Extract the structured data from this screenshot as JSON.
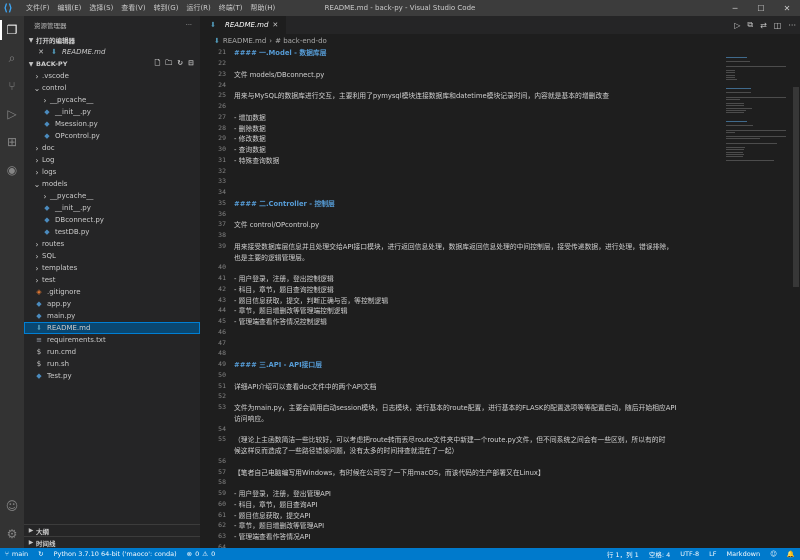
{
  "titlebar": {
    "title": "README.md - back-py - Visual Studio Code",
    "menu": [
      "文件(F)",
      "编辑(E)",
      "选择(S)",
      "查看(V)",
      "转到(G)",
      "运行(R)",
      "终端(T)",
      "帮助(H)"
    ]
  },
  "sidebar": {
    "header": "资源管理器",
    "open_editors_label": "打开的编辑器",
    "open_editor_file": "README.md",
    "project_label": "BACK-PY",
    "bottom_sections": [
      "大纲",
      "时间线"
    ]
  },
  "tree": [
    {
      "label": ".vscode",
      "type": "folder",
      "depth": 1,
      "expanded": false
    },
    {
      "label": "control",
      "type": "folder",
      "depth": 1,
      "expanded": true
    },
    {
      "label": "__pycache__",
      "type": "folder",
      "depth": 2,
      "expanded": false
    },
    {
      "label": "__init__.py",
      "type": "py",
      "depth": 2
    },
    {
      "label": "Msession.py",
      "type": "py",
      "depth": 2
    },
    {
      "label": "OPcontrol.py",
      "type": "py",
      "depth": 2
    },
    {
      "label": "doc",
      "type": "folder",
      "depth": 1,
      "expanded": false
    },
    {
      "label": "Log",
      "type": "folder",
      "depth": 1,
      "expanded": false
    },
    {
      "label": "logs",
      "type": "folder",
      "depth": 1,
      "expanded": false
    },
    {
      "label": "models",
      "type": "folder",
      "depth": 1,
      "expanded": true
    },
    {
      "label": "__pycache__",
      "type": "folder",
      "depth": 2,
      "expanded": false
    },
    {
      "label": "__init__.py",
      "type": "py",
      "depth": 2
    },
    {
      "label": "DBconnect.py",
      "type": "py",
      "depth": 2
    },
    {
      "label": "testDB.py",
      "type": "py",
      "depth": 2
    },
    {
      "label": "routes",
      "type": "folder",
      "depth": 1,
      "expanded": false
    },
    {
      "label": "SQL",
      "type": "folder",
      "depth": 1,
      "expanded": false
    },
    {
      "label": "templates",
      "type": "folder",
      "depth": 1,
      "expanded": false
    },
    {
      "label": "test",
      "type": "folder",
      "depth": 1,
      "expanded": false
    },
    {
      "label": ".gitignore",
      "type": "git",
      "depth": 1
    },
    {
      "label": "app.py",
      "type": "py",
      "depth": 1
    },
    {
      "label": "main.py",
      "type": "py",
      "depth": 1
    },
    {
      "label": "README.md",
      "type": "md",
      "depth": 1,
      "selected": true
    },
    {
      "label": "requirements.txt",
      "type": "txt",
      "depth": 1
    },
    {
      "label": "run.cmd",
      "type": "cmd",
      "depth": 1
    },
    {
      "label": "run.sh",
      "type": "cmd",
      "depth": 1
    },
    {
      "label": "Test.py",
      "type": "py",
      "depth": 1
    }
  ],
  "editor": {
    "tab_label": "README.md",
    "breadcrumb": [
      "README.md",
      "# back-end-do"
    ],
    "lines": [
      {
        "n": "21",
        "text": "#### 一.Model - 数据库层",
        "kind": "h4"
      },
      {
        "n": "22",
        "text": "",
        "kind": "text"
      },
      {
        "n": "23",
        "text": "文件 models/DBconnect.py",
        "kind": "text"
      },
      {
        "n": "24",
        "text": "",
        "kind": "text"
      },
      {
        "n": "25",
        "text": "用来与MySQL的数据库进行交互，主要利用了pymysql模块连接数据库和datetime模块记录时间，内容就是基本的增删改查",
        "kind": "text"
      },
      {
        "n": "26",
        "text": "",
        "kind": "text"
      },
      {
        "n": "27",
        "text": "- 增加数据",
        "kind": "list"
      },
      {
        "n": "28",
        "text": "- 删除数据",
        "kind": "list"
      },
      {
        "n": "29",
        "text": "- 修改数据",
        "kind": "list"
      },
      {
        "n": "30",
        "text": "- 查询数据",
        "kind": "list"
      },
      {
        "n": "31",
        "text": "- 特殊查询数据",
        "kind": "list"
      },
      {
        "n": "32",
        "text": "",
        "kind": "text"
      },
      {
        "n": "33",
        "text": "",
        "kind": "text"
      },
      {
        "n": "34",
        "text": "",
        "kind": "text"
      },
      {
        "n": "35",
        "text": "#### 二.Controller - 控制层",
        "kind": "h4"
      },
      {
        "n": "36",
        "text": "",
        "kind": "text"
      },
      {
        "n": "37",
        "text": "文件 control/OPcontrol.py",
        "kind": "text"
      },
      {
        "n": "38",
        "text": "",
        "kind": "text"
      },
      {
        "n": "39",
        "text": "用来接受数据库层信息并且处理交给API接口模块，进行返回信息处理，数据库返回信息处理的中间控制层，接受传递数据，进行处理，错误排除，",
        "kind": "text"
      },
      {
        "n": "",
        "text": "也是主要的逻辑管理层。",
        "kind": "text"
      },
      {
        "n": "40",
        "text": "",
        "kind": "text"
      },
      {
        "n": "41",
        "text": "- 用户登录，注册，登出控制逻辑",
        "kind": "list"
      },
      {
        "n": "42",
        "text": "- 科目，章节，题目查询控制逻辑",
        "kind": "list"
      },
      {
        "n": "43",
        "text": "- 题目信息获取，提交，判断正确与否，等控制逻辑",
        "kind": "list"
      },
      {
        "n": "44",
        "text": "- 章节，题目增删改等管理端控制逻辑",
        "kind": "list"
      },
      {
        "n": "45",
        "text": "- 管理端查看作答情况控制逻辑",
        "kind": "list"
      },
      {
        "n": "46",
        "text": "",
        "kind": "text"
      },
      {
        "n": "47",
        "text": "",
        "kind": "text"
      },
      {
        "n": "48",
        "text": "",
        "kind": "text"
      },
      {
        "n": "49",
        "text": "#### 三.API - API接口层",
        "kind": "h4"
      },
      {
        "n": "50",
        "text": "",
        "kind": "text"
      },
      {
        "n": "51",
        "text": "详细API介绍可以查看doc文件中的两个API文档",
        "kind": "text"
      },
      {
        "n": "52",
        "text": "",
        "kind": "text"
      },
      {
        "n": "53",
        "text": "文件为main.py，主要会调用启动session模块，日志模块，进行基本的route配置，进行基本的FLASK的配置选项等等配置启动，随后开始相应API",
        "kind": "text"
      },
      {
        "n": "",
        "text": "访问响应。",
        "kind": "text"
      },
      {
        "n": "54",
        "text": "",
        "kind": "text"
      },
      {
        "n": "55",
        "text": "（理论上主函数简洁一些比较好，可以考虑把route转而丢尽route文件夹中新建一个route.py文件，但不同系统之间会有一些区别，所以有的时",
        "kind": "text"
      },
      {
        "n": "",
        "text": "候这样反而造成了一些路径错误问题，没有太多的时间排查就混在了一起）",
        "kind": "text"
      },
      {
        "n": "56",
        "text": "",
        "kind": "text"
      },
      {
        "n": "57",
        "text": "【笔者自己电脑编写用Windows，有时候在公司写了一下用macOS，而该代码的生产部署又在Linux】",
        "kind": "text"
      },
      {
        "n": "58",
        "text": "",
        "kind": "text"
      },
      {
        "n": "59",
        "text": "- 用户登录，注册，登出管理API",
        "kind": "list"
      },
      {
        "n": "60",
        "text": "- 科目，章节，题目查询API",
        "kind": "list"
      },
      {
        "n": "61",
        "text": "- 题目信息获取，提交API",
        "kind": "list"
      },
      {
        "n": "62",
        "text": "- 章节，题目增删改等管理API",
        "kind": "list"
      },
      {
        "n": "63",
        "text": "- 管理端查看作答情况API",
        "kind": "list"
      },
      {
        "n": "64",
        "text": "",
        "kind": "text"
      },
      {
        "n": "65",
        "text": "session技术是一个可以判断该用户是否存活的技术，一旦用户从浏览器退出了，就自动需要重新登陆）",
        "kind": "text"
      },
      {
        "n": "66",
        "text": "",
        "kind": "text"
      }
    ]
  },
  "statusbar": {
    "branch": "main",
    "interpreter": "Python 3.7.10 64-bit ('maoco': conda)",
    "errors": "0",
    "warnings": "0",
    "position": "行 1，列 1",
    "spaces": "空格: 4",
    "encoding": "UTF-8",
    "eol": "LF",
    "language": "Markdown"
  },
  "colors": {
    "statusbar": "#007acc",
    "selection": "#094771",
    "heading": "#569cd6"
  }
}
